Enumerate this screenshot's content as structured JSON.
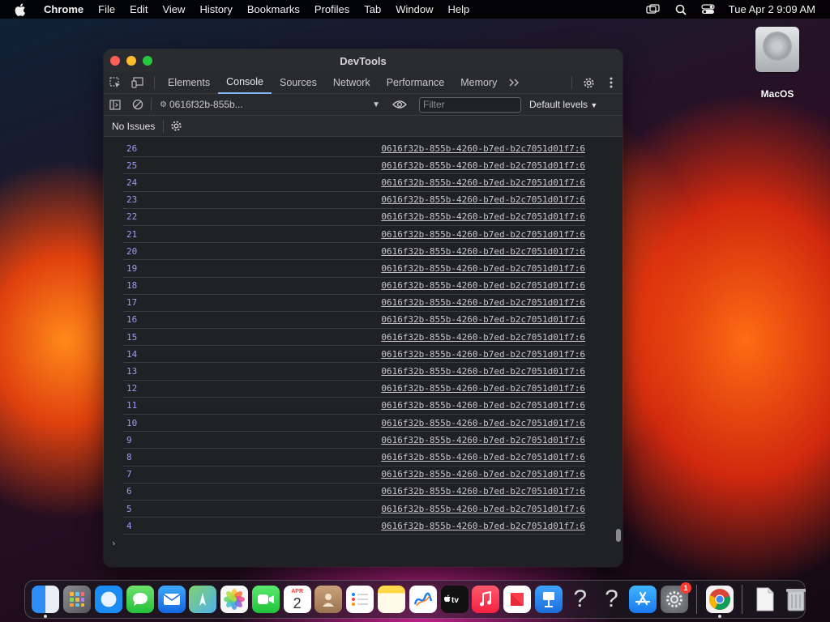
{
  "menubar": {
    "app_name": "Chrome",
    "items": [
      "File",
      "Edit",
      "View",
      "History",
      "Bookmarks",
      "Profiles",
      "Tab",
      "Window",
      "Help"
    ],
    "clock": "Tue Apr 2  9:09 AM"
  },
  "desktop": {
    "disk_label": "MacOS"
  },
  "window": {
    "title": "DevTools",
    "tabs": [
      "Elements",
      "Console",
      "Sources",
      "Network",
      "Performance",
      "Memory"
    ],
    "active_tab": "Console",
    "context_label": "0616f32b-855b...",
    "filter_placeholder": "Filter",
    "levels_label": "Default levels",
    "issues_label": "No Issues",
    "source_link": "0616f32b-855b-4260-b7ed-b2c7051d01f7:6",
    "log_numbers": [
      "26",
      "25",
      "24",
      "23",
      "22",
      "21",
      "20",
      "19",
      "18",
      "17",
      "16",
      "15",
      "14",
      "13",
      "12",
      "11",
      "10",
      "9",
      "8",
      "7",
      "6",
      "5",
      "4"
    ],
    "prompt_symbol": "›"
  },
  "dock": {
    "calendar_month": "APR",
    "calendar_day": "2",
    "settings_badge": "1",
    "accent": "#1a73e8"
  }
}
